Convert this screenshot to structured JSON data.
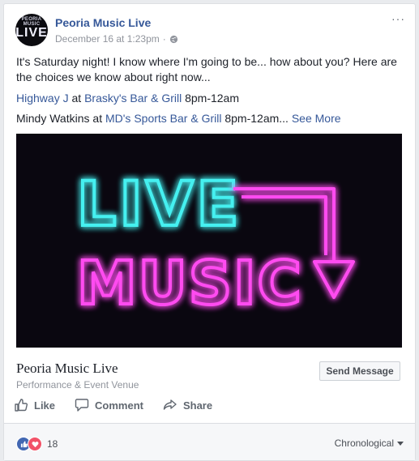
{
  "post": {
    "author": "Peoria Music Live",
    "timestamp": "December 16 at 1:23pm",
    "separator": "·",
    "visibility_icon": "globe-icon",
    "more_icon": "ellipsis-icon",
    "more_text": "···",
    "avatar": {
      "arc_text": "PEORIA MUSIC",
      "main_text": "LIVE"
    },
    "text_intro": "It's Saturday night! I know where I'm going to be... how about you? Here are the choices we know about right now...",
    "line1": {
      "artist": "Highway J",
      "at": " at ",
      "venue": "Brasky's Bar & Grill",
      "time": " 8pm-12am"
    },
    "line2": {
      "artist": "Mindy Watkins",
      "at": " at ",
      "venue": "MD's Sports Bar & Grill",
      "time": " 8pm-12am...",
      "see_more": " See More"
    },
    "image": {
      "word1": "LIVE",
      "word2": "MUSIC",
      "colors": {
        "cyan": "#45f0f0",
        "magenta": "#ff4cf0",
        "bg": "#0a0710"
      }
    }
  },
  "link_preview": {
    "title": "Peoria Music Live",
    "subtitle": "Performance & Event Venue",
    "button": "Send Message"
  },
  "actions": [
    {
      "label": "Like",
      "icon": "thumbs-up-icon"
    },
    {
      "label": "Comment",
      "icon": "comment-icon"
    },
    {
      "label": "Share",
      "icon": "share-arrow-icon"
    }
  ],
  "footer": {
    "reaction_icons": [
      "like-reaction-icon",
      "love-reaction-icon"
    ],
    "reaction_count": "18",
    "sort_label": "Chronological",
    "sort_icon": "caret-down-icon"
  },
  "colors": {
    "link": "#365899",
    "meta": "#90949c",
    "action": "#606770"
  }
}
